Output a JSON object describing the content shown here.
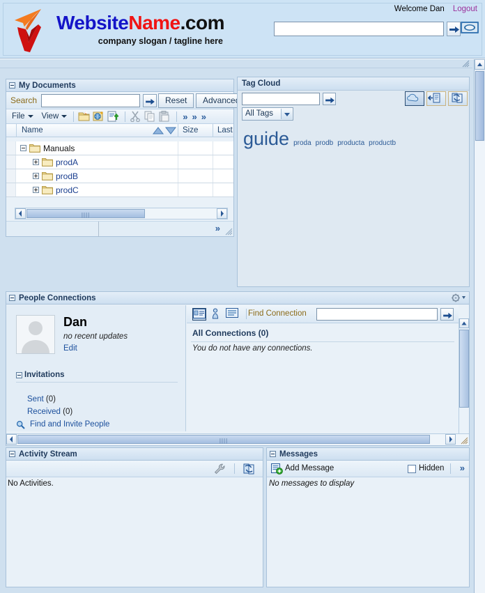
{
  "header": {
    "welcome": "Welcome Dan",
    "logout": "Logout",
    "brand_part1": "Website",
    "brand_part2": "Name",
    "brand_part3": ".com",
    "slogan": "company slogan / tagline here",
    "search_value": "",
    "search_placeholder": ""
  },
  "documents": {
    "title": "My Documents",
    "search_label": "Search",
    "search_value": "",
    "reset_label": "Reset",
    "advanced_label": "Advanced",
    "menus": {
      "file": "File",
      "view": "View"
    },
    "overflow": "»",
    "columns": {
      "name": "Name",
      "size": "Size",
      "last": "Last"
    },
    "rows": [
      {
        "name": "Manuals",
        "expanded": true,
        "level": 0,
        "size": "",
        "last": ""
      },
      {
        "name": "prodA",
        "expanded": false,
        "level": 1,
        "size": "",
        "last": ""
      },
      {
        "name": "prodB",
        "expanded": false,
        "level": 1,
        "size": "",
        "last": ""
      },
      {
        "name": "prodC",
        "expanded": false,
        "level": 1,
        "size": "",
        "last": ""
      }
    ],
    "footer_overflow": "»"
  },
  "tagcloud": {
    "title": "Tag Cloud",
    "search_value": "",
    "filter_selected": "All Tags",
    "filter_options": [
      "All Tags"
    ],
    "tags": [
      {
        "label": "guide",
        "size": "xl"
      },
      {
        "label": "proda",
        "size": "sm"
      },
      {
        "label": "prodb",
        "size": "sm"
      },
      {
        "label": "producta",
        "size": "sm"
      },
      {
        "label": "productb",
        "size": "sm"
      }
    ]
  },
  "people": {
    "title": "People Connections",
    "user_name": "Dan",
    "user_status": "no recent updates",
    "edit_label": "Edit",
    "invitations_label": "Invitations",
    "sent_label": "Sent",
    "sent_count": "(0)",
    "received_label": "Received",
    "received_count": "(0)",
    "find_invite_label": "Find and Invite People",
    "connection_lists_label": "Connection Lists",
    "find_connection_label": "Find Connection",
    "find_connection_value": "",
    "all_connections_label": "All Connections (0)",
    "empty_text": "You do not have any connections."
  },
  "activity": {
    "title": "Activity Stream",
    "empty_text": "No Activities."
  },
  "messages": {
    "title": "Messages",
    "add_label": "Add Message",
    "hidden_label": "Hidden",
    "hidden_checked": false,
    "overflow": "»",
    "empty_text": "No messages to display"
  },
  "colors": {
    "accent_blue": "#1b4f9c",
    "brand_blue": "#1414c8",
    "brand_red": "#f01414",
    "link_purple": "#9b309b",
    "label_olive": "#8a6a18",
    "panel_bg": "#e9f1f8",
    "canvas_bg": "#cfe0ef"
  }
}
